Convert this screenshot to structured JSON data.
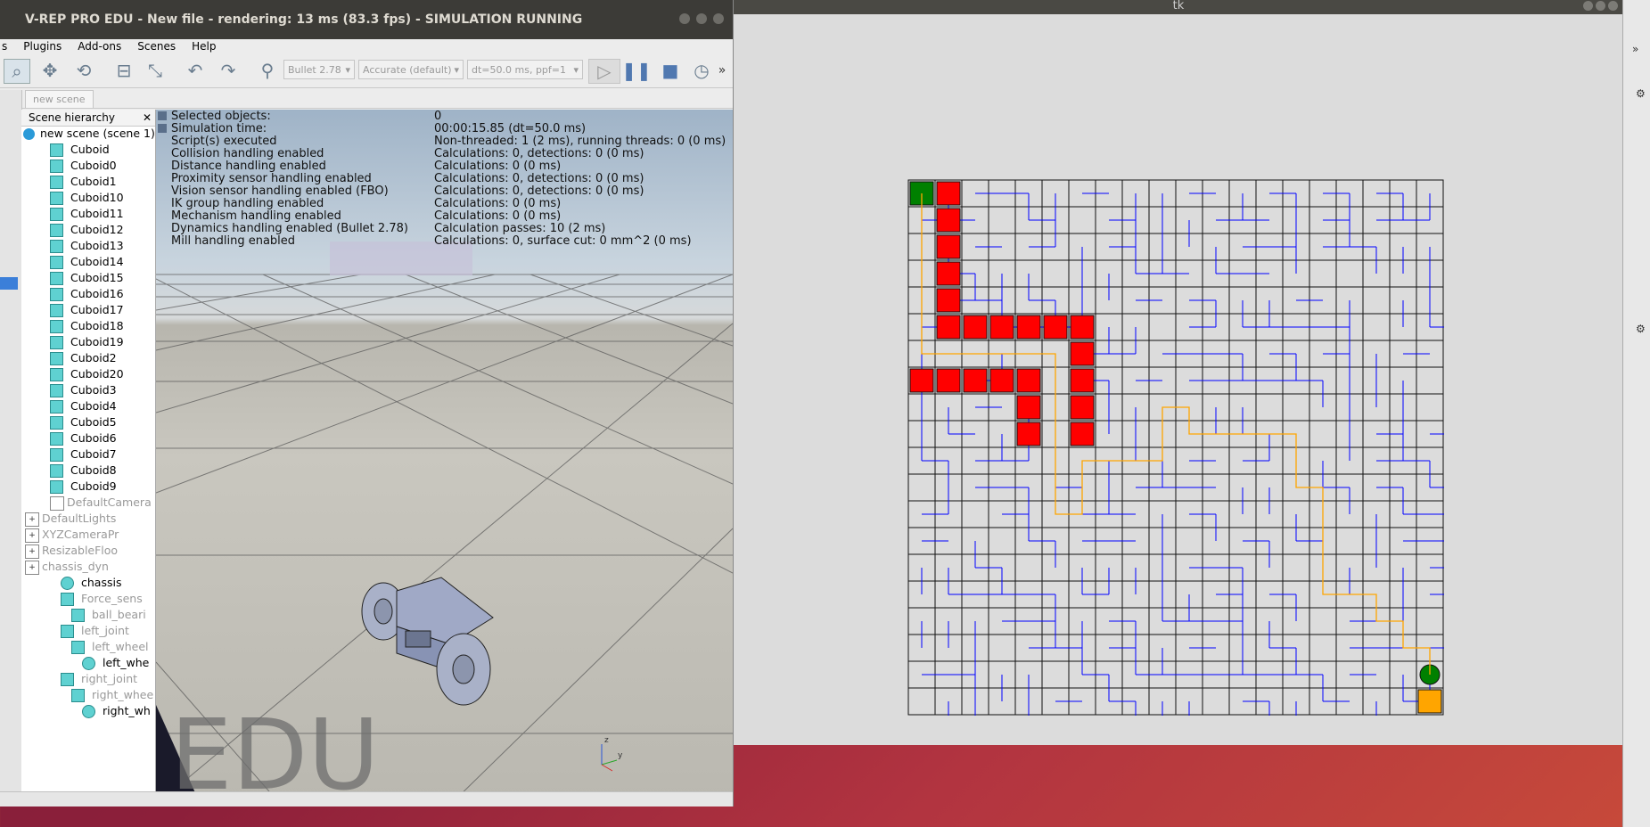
{
  "vrep": {
    "title": "V-REP PRO EDU - New file - rendering: 13 ms (83.3 fps) - SIMULATION RUNNING",
    "menu": [
      "s",
      "Plugins",
      "Add-ons",
      "Scenes",
      "Help"
    ],
    "toolbar": {
      "engine": "Bullet 2.78",
      "accuracy": "Accurate (default)",
      "timestep": "dt=50.0 ms, ppf=1",
      "more": "»"
    },
    "tab": "new scene",
    "hierarchy": {
      "title": "Scene hierarchy",
      "close": "✕",
      "root": "new scene (scene 1)",
      "items": [
        "Cuboid",
        "Cuboid0",
        "Cuboid1",
        "Cuboid10",
        "Cuboid11",
        "Cuboid12",
        "Cuboid13",
        "Cuboid14",
        "Cuboid15",
        "Cuboid16",
        "Cuboid17",
        "Cuboid18",
        "Cuboid19",
        "Cuboid2",
        "Cuboid20",
        "Cuboid3",
        "Cuboid4",
        "Cuboid5",
        "Cuboid6",
        "Cuboid7",
        "Cuboid8",
        "Cuboid9"
      ],
      "others": [
        "DefaultCamera",
        "DefaultLights",
        "XYZCameraPr",
        "ResizableFloo",
        "chassis_dyn",
        "chassis",
        "Force_sens",
        "ball_beari",
        "left_joint",
        "left_wheel",
        "left_whe",
        "right_joint",
        "right_whee",
        "right_wh"
      ]
    },
    "info": {
      "labels": [
        "Selected objects:",
        "Simulation time:",
        "Script(s) executed",
        "Collision handling enabled",
        "Distance handling enabled",
        "Proximity sensor handling enabled",
        "Vision sensor handling enabled (FBO)",
        "IK group handling enabled",
        "Mechanism handling enabled",
        "Dynamics handling enabled (Bullet 2.78)",
        "Mill handling enabled"
      ],
      "values": [
        "0",
        "00:00:15.85 (dt=50.0 ms)",
        "Non-threaded: 1 (2 ms), running threads: 0 (0 ms)",
        "Calculations: 0, detections: 0 (0 ms)",
        "Calculations: 0 (0 ms)",
        "Calculations: 0, detections: 0 (0 ms)",
        "Calculations: 0, detections: 0 (0 ms)",
        "Calculations: 0 (0 ms)",
        "Calculations: 0 (0 ms)",
        "Calculation passes: 10 (2 ms)",
        "Calculations: 0, surface cut: 0 mm^2 (0 ms)"
      ]
    },
    "watermark": "EDU",
    "axis_labels": {
      "z": "z",
      "y": "y"
    }
  },
  "tk": {
    "title": "tk",
    "grid": {
      "rows": 20,
      "cols": 20
    },
    "red_cells": [
      [
        0,
        1
      ],
      [
        1,
        1
      ],
      [
        2,
        1
      ],
      [
        3,
        1
      ],
      [
        4,
        1
      ],
      [
        5,
        1
      ],
      [
        5,
        2
      ],
      [
        5,
        3
      ],
      [
        5,
        4
      ],
      [
        5,
        5
      ],
      [
        5,
        6
      ],
      [
        6,
        6
      ],
      [
        7,
        0
      ],
      [
        7,
        1
      ],
      [
        7,
        2
      ],
      [
        7,
        3
      ],
      [
        7,
        4
      ],
      [
        7,
        6
      ],
      [
        8,
        4
      ],
      [
        8,
        6
      ],
      [
        9,
        4
      ],
      [
        9,
        6
      ]
    ],
    "start_cell": [
      0,
      0
    ],
    "goal_cell": [
      19,
      19
    ],
    "robot_cell": [
      18,
      19
    ],
    "colors": {
      "wall": "#0000ff",
      "path": "#ffa500",
      "obstacle": "#ff0000",
      "start": "#008000",
      "goal": "#ffa500",
      "robot": "#008000"
    }
  },
  "edge": {
    "more": "»"
  }
}
